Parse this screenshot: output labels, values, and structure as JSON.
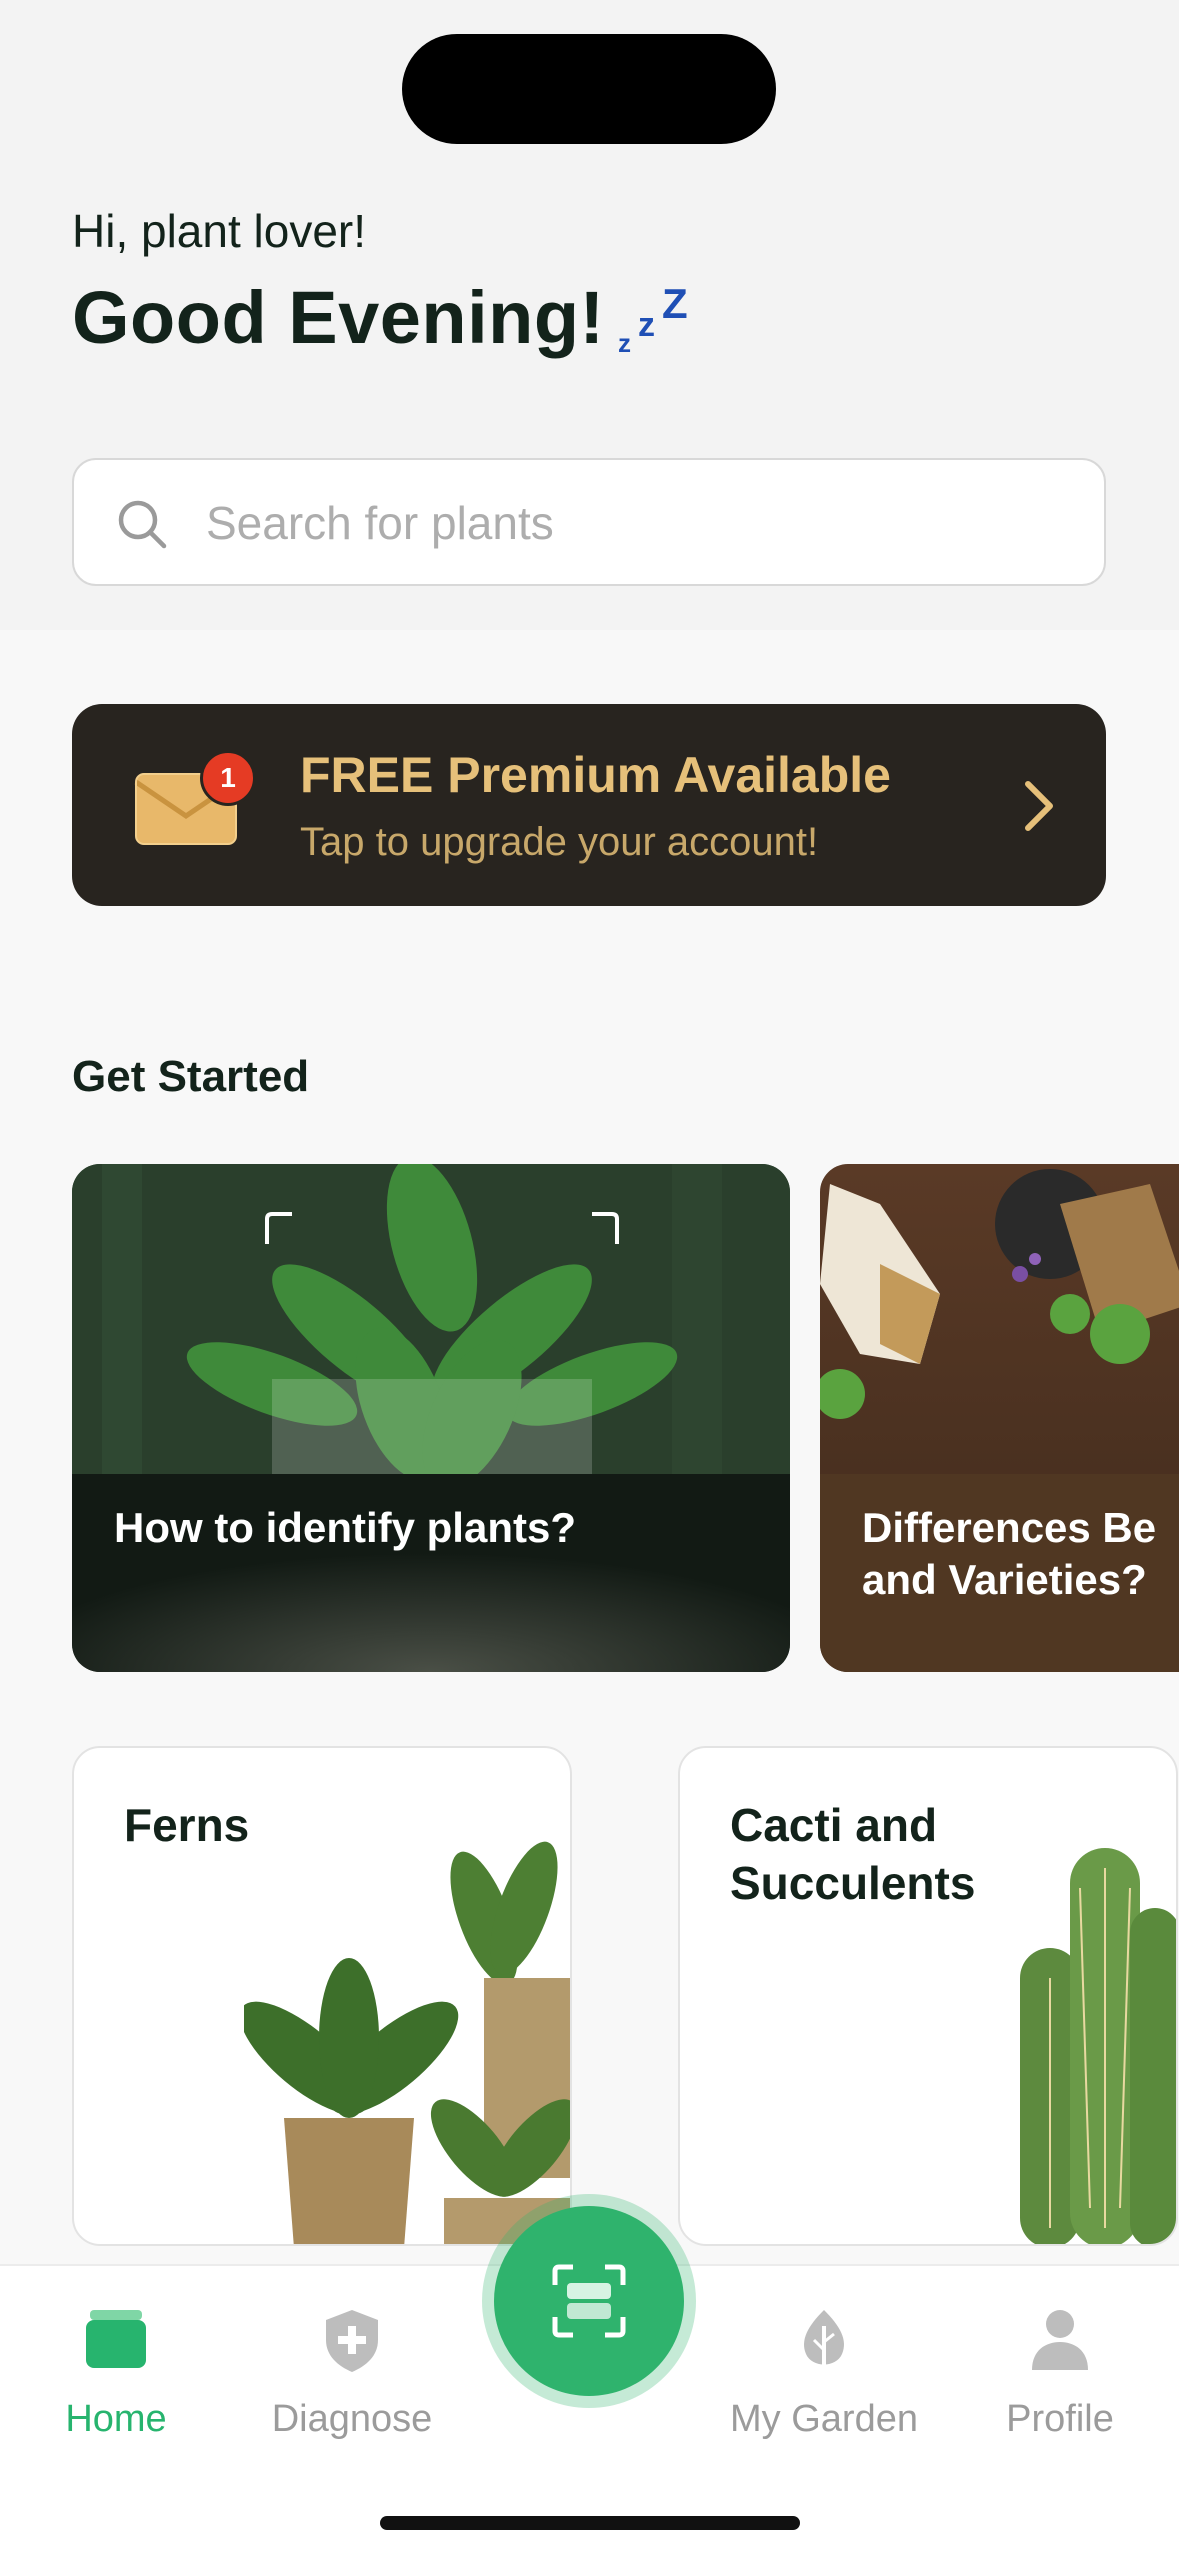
{
  "header": {
    "greeting": "Hi, plant lover!",
    "title": "Good Evening!",
    "title_icon": "sleep-zzz-icon"
  },
  "search": {
    "placeholder": "Search for plants",
    "value": ""
  },
  "premium_banner": {
    "title_bold": "FREE",
    "title_rest": " Premium Available",
    "subtitle": "Tap to upgrade your account!",
    "badge_count": "1",
    "icon": "mail-icon",
    "colors": {
      "background": "#28241f",
      "text": "#e6c07a",
      "badge": "#e53b24"
    }
  },
  "get_started": {
    "title": "Get Started",
    "cards": [
      {
        "label": "How to identify plants?"
      },
      {
        "label": "Differences Be\nand Varieties?"
      }
    ]
  },
  "categories": [
    {
      "label": "Ferns"
    },
    {
      "label": "Cacti and Succulents"
    }
  ],
  "tabbar": {
    "accent": "#27b46e",
    "items": [
      {
        "label": "Home",
        "icon": "home-icon",
        "active": true
      },
      {
        "label": "Diagnose",
        "icon": "shield-plus-icon",
        "active": false
      },
      {
        "label": "My Garden",
        "icon": "leaf-icon",
        "active": false
      },
      {
        "label": "Profile",
        "icon": "person-icon",
        "active": false
      }
    ],
    "scan_icon": "scan-icon"
  }
}
